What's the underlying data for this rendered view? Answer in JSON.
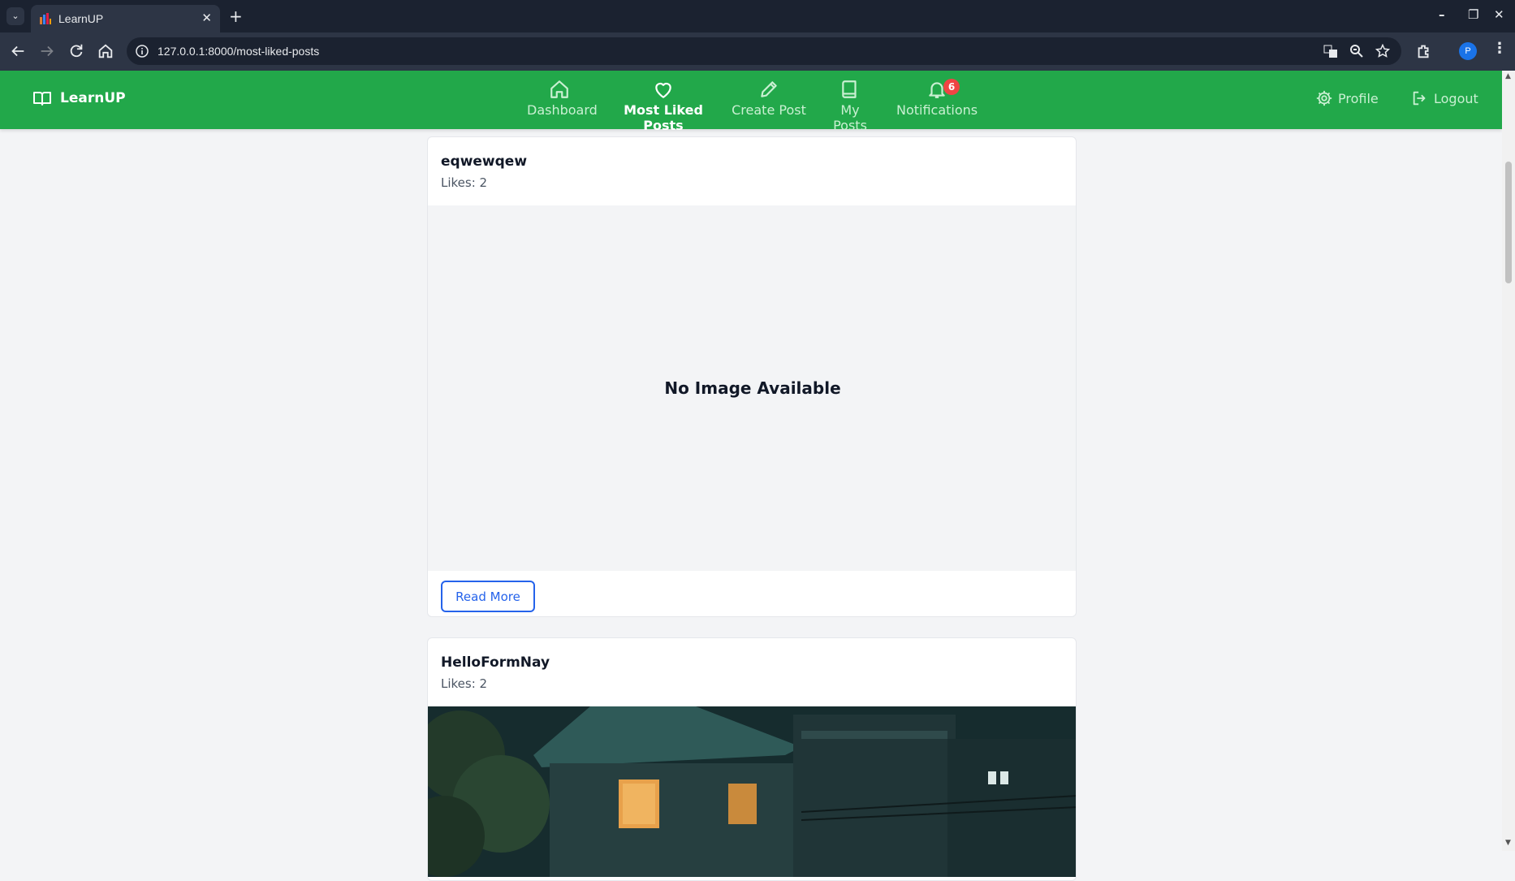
{
  "browser": {
    "tab_title": "LearnUP",
    "url": "127.0.0.1:8000/most-liked-posts",
    "profile_initial": "P"
  },
  "navbar": {
    "brand": "LearnUP",
    "items": [
      {
        "label": "Dashboard",
        "icon": "home-icon"
      },
      {
        "label": "Most Liked Posts",
        "icon": "heart-icon",
        "active": true
      },
      {
        "label": "Create Post",
        "icon": "pencil-icon"
      },
      {
        "label": "My Posts",
        "icon": "book-icon"
      },
      {
        "label": "Notifications",
        "icon": "bell-icon",
        "badge": "6"
      }
    ],
    "profile_label": "Profile",
    "logout_label": "Logout",
    "color": "#22a84a"
  },
  "posts": [
    {
      "title": "eqwewqew",
      "likes": "Likes: 2",
      "image_placeholder": "No Image Available",
      "read_more": "Read More"
    },
    {
      "title": "HelloFormNay",
      "likes": "Likes: 2"
    }
  ]
}
